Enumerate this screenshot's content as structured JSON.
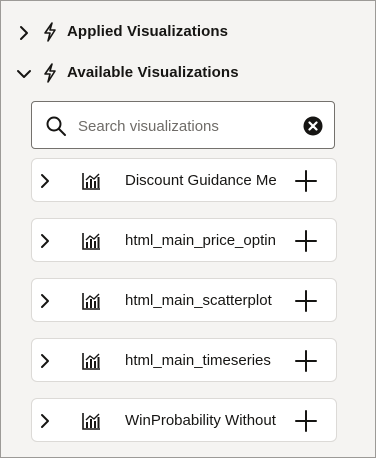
{
  "sections": {
    "applied": {
      "title": "Applied Visualizations",
      "expanded": false,
      "icon": "bolt-icon"
    },
    "available": {
      "title": "Available Visualizations",
      "expanded": true,
      "icon": "bolt-icon"
    }
  },
  "search": {
    "placeholder": "Search visualizations",
    "value": "",
    "icon": "search-icon",
    "clear_icon": "clear-icon"
  },
  "visualizations": [
    {
      "label": "Discount Guidance Me",
      "icon": "bar-chart-icon"
    },
    {
      "label": "html_main_price_optin",
      "icon": "bar-chart-icon"
    },
    {
      "label": "html_main_scatterplot",
      "icon": "bar-chart-icon"
    },
    {
      "label": "html_main_timeseries",
      "icon": "bar-chart-icon"
    },
    {
      "label": "WinProbability Without",
      "icon": "bar-chart-icon"
    }
  ],
  "colors": {
    "text": "#161513",
    "border": "#9c9a97",
    "background": "#f5f4f2"
  }
}
